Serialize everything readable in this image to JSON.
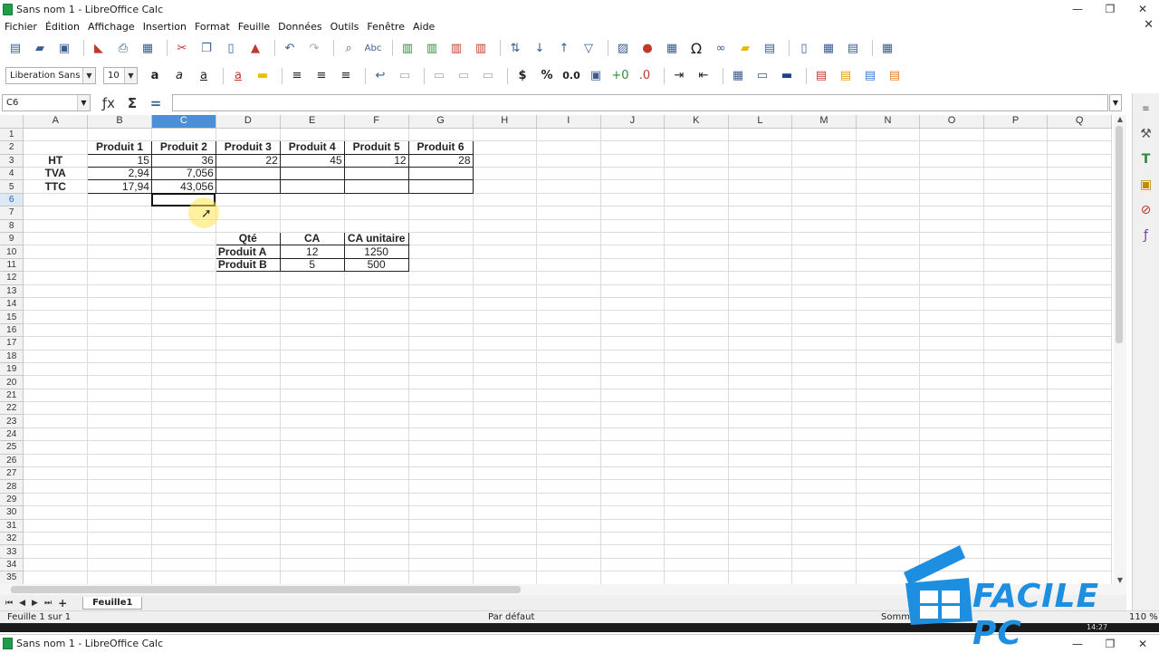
{
  "window": {
    "title": "Sans nom 1 - LibreOffice Calc",
    "minimize": "—",
    "restore": "❐",
    "close": "✕"
  },
  "menu": [
    "Fichier",
    "Édition",
    "Affichage",
    "Insertion",
    "Format",
    "Feuille",
    "Données",
    "Outils",
    "Fenêtre",
    "Aide"
  ],
  "menu_close": "✕",
  "font": {
    "name": "Liberation Sans",
    "size": "10"
  },
  "formula": {
    "cellref": "C6",
    "value": ""
  },
  "columns": [
    "A",
    "B",
    "C",
    "D",
    "E",
    "F",
    "G",
    "H",
    "I",
    "J",
    "K",
    "L",
    "M",
    "N",
    "O",
    "P",
    "Q"
  ],
  "rows": [
    [
      "",
      "",
      "",
      "",
      "",
      "",
      ""
    ],
    [
      "",
      "Produit 1",
      "Produit 2",
      "Produit 3",
      "Produit 4",
      "Produit 5",
      "Produit 6"
    ],
    [
      "HT",
      "15",
      "36",
      "22",
      "45",
      "12",
      "28"
    ],
    [
      "TVA",
      "2,94",
      "7,056",
      "",
      "",
      "",
      ""
    ],
    [
      "TTC",
      "17,94",
      "43,056",
      "",
      "",
      "",
      ""
    ],
    [
      "",
      "",
      "",
      "",
      "",
      "",
      ""
    ],
    [
      "",
      "",
      "",
      "",
      "",
      "",
      ""
    ],
    [
      "",
      "",
      "",
      "",
      "",
      "",
      ""
    ],
    [
      "",
      "",
      "",
      "Qté",
      "CA",
      "CA unitaire",
      ""
    ],
    [
      "",
      "",
      "",
      "Produit A",
      "12",
      "1250",
      ""
    ],
    [
      "",
      "",
      "",
      "Produit B",
      "5",
      "500",
      ""
    ]
  ],
  "row_count": 35,
  "selected": {
    "cell": "C6",
    "col": "C",
    "row": 6
  },
  "sheet_tab": "Feuille1",
  "status": {
    "sheet": "Feuille 1 sur 1",
    "style": "Par défaut",
    "sum": "Somm",
    "zoom": "110 %"
  },
  "taskbar_clock": "14:27",
  "second_window_title": "Sans nom 1 - LibreOffice Calc",
  "watermark": "FACILE PC",
  "colors": {
    "accent": "#4a8fd8",
    "logo": "#1e8fe0"
  }
}
